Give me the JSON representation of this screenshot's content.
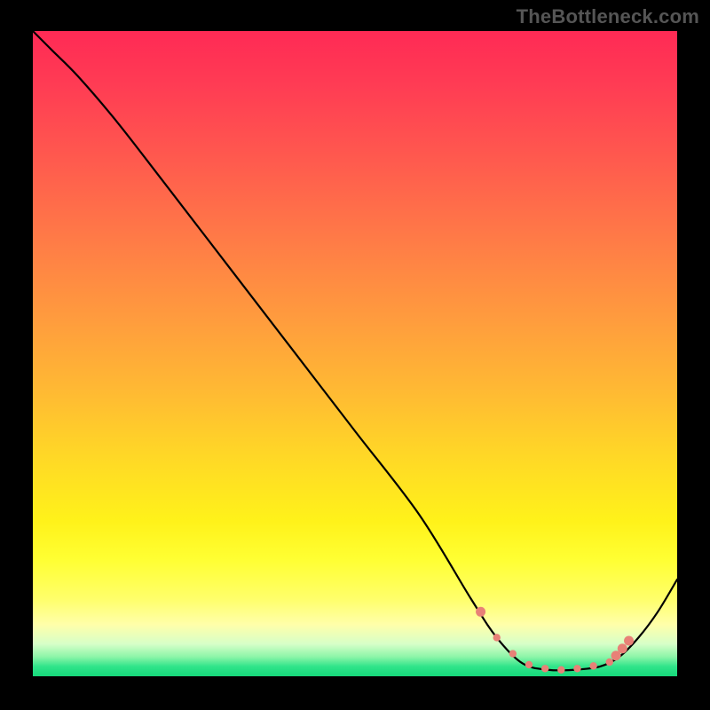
{
  "watermark": "TheBottleneck.com",
  "chart_data": {
    "type": "line",
    "title": "",
    "xlabel": "",
    "ylabel": "",
    "xlim": [
      0,
      1
    ],
    "ylim": [
      0,
      1
    ],
    "series": [
      {
        "name": "curve",
        "x": [
          0.0,
          0.03,
          0.07,
          0.13,
          0.2,
          0.3,
          0.4,
          0.5,
          0.6,
          0.68,
          0.72,
          0.76,
          0.8,
          0.84,
          0.88,
          0.91,
          0.94,
          0.97,
          1.0
        ],
        "y": [
          1.0,
          0.97,
          0.93,
          0.86,
          0.77,
          0.64,
          0.51,
          0.38,
          0.25,
          0.12,
          0.06,
          0.02,
          0.01,
          0.01,
          0.015,
          0.03,
          0.06,
          0.1,
          0.15
        ]
      }
    ],
    "markers": {
      "name": "dotted-segment",
      "x": [
        0.695,
        0.72,
        0.745,
        0.77,
        0.795,
        0.82,
        0.845,
        0.87,
        0.895,
        0.905,
        0.915,
        0.925
      ],
      "y": [
        0.1,
        0.06,
        0.035,
        0.018,
        0.012,
        0.01,
        0.012,
        0.016,
        0.022,
        0.032,
        0.043,
        0.055
      ]
    },
    "gradient_stops": [
      {
        "pos": 0.0,
        "color": "#ff2a55"
      },
      {
        "pos": 0.5,
        "color": "#ffba33"
      },
      {
        "pos": 0.8,
        "color": "#ffff33"
      },
      {
        "pos": 0.96,
        "color": "#cfffc0"
      },
      {
        "pos": 1.0,
        "color": "#16d97b"
      }
    ]
  }
}
